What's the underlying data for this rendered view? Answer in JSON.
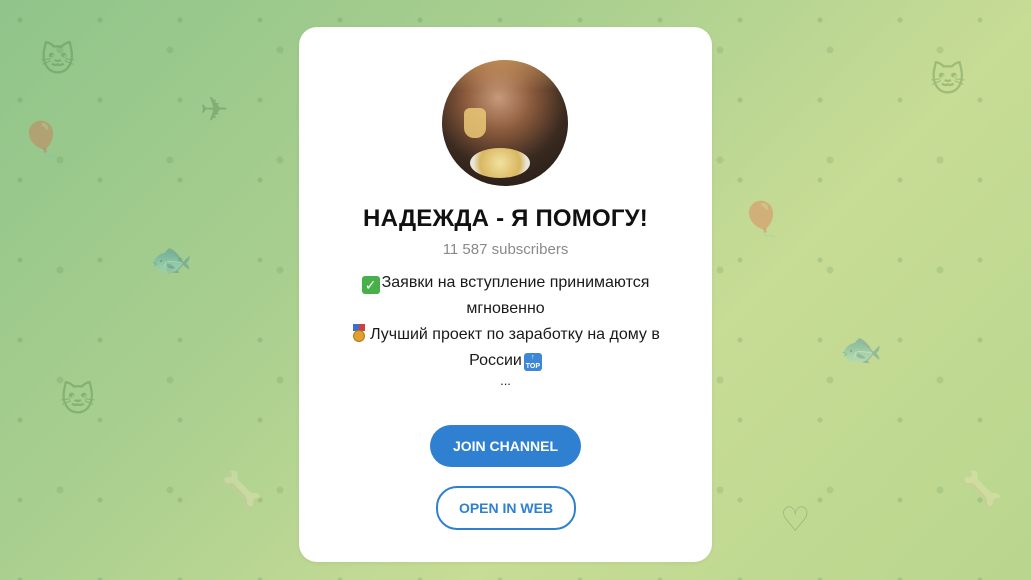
{
  "channel": {
    "title": "НАДЕЖДА - Я ПОМОГУ!",
    "subscribers": "11 587 subscribers",
    "description": {
      "line1": "Заявки на вступление принимаются",
      "line2": "мгновенно",
      "line3": "Лучший проект по заработку на дому в",
      "line4": "России",
      "more": "..."
    },
    "icons": {
      "check": "check-mark-emoji",
      "medal": "medal-emoji",
      "top": "top-arrow-emoji"
    }
  },
  "buttons": {
    "join": "JOIN CHANNEL",
    "web": "OPEN IN WEB"
  },
  "colors": {
    "accent": "#2f80d1",
    "background_start": "#8fc48a",
    "background_end": "#c7dc95"
  }
}
